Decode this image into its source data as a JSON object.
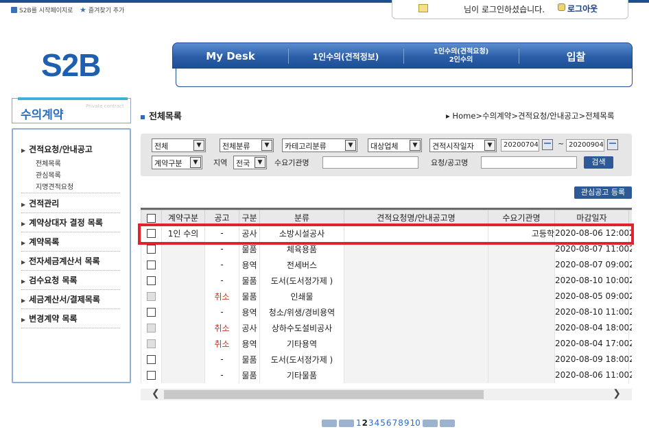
{
  "top_links": {
    "start_page": "S2B를 시작페이지로",
    "favorite": "즐겨찾기 추가"
  },
  "login": {
    "message": "님이 로그인하셨습니다.",
    "logout": "로그아웃"
  },
  "logo": "S2B",
  "nav": {
    "items": [
      {
        "line1": "My Desk",
        "line2": ""
      },
      {
        "line1": "1인수의(견적정보)",
        "line2": ""
      },
      {
        "line1": "1인수의(견적요청)",
        "line2": "2인수의"
      },
      {
        "line1": "입찰",
        "line2": ""
      }
    ]
  },
  "sidebar": {
    "title": "수의계약",
    "subtitle": "Private contract",
    "items": [
      {
        "label": "견적요청/안내공고"
      },
      {
        "label": "견적관리"
      },
      {
        "label": "계약상대자 결정 목록"
      },
      {
        "label": "계약목록"
      },
      {
        "label": "전자세금계산서 목록"
      },
      {
        "label": "검수요청 목록"
      },
      {
        "label": "세금계산서/결제목록"
      },
      {
        "label": "변경계약 목록"
      }
    ],
    "subitems": [
      "전체목록",
      "관심목록",
      "지명견적요청"
    ]
  },
  "page": {
    "title": "전체목록",
    "breadcrumb": "▸ Home>수의계약>견적요청/안내공고>전체목록"
  },
  "filter": {
    "sel_all": "전체",
    "sel_class": "전체분류",
    "sel_category": "카테고리분류",
    "sel_target": "대상업체",
    "sel_datetype": "견적시작일자",
    "date_from": "20200704",
    "tilde": "~",
    "date_to": "20200904",
    "sel_contract": "계약구분",
    "label_region": "지역",
    "sel_region": "전국",
    "label_agency": "수요기관명",
    "label_title": "요청/공고명",
    "search_button": "검색"
  },
  "register_button": "관심공고 등록",
  "table": {
    "headers": [
      "",
      "계약구분",
      "공고",
      "구분",
      "분류",
      "견적요청명/안내공고명",
      "수요기관명",
      "마감일자",
      ""
    ],
    "rows": [
      {
        "contract": "1인 수의",
        "notice": "-",
        "type": "공사",
        "category": "소방시설공사",
        "title": "",
        "agency": "고등학",
        "deadline": "2020-08-06 12:00",
        "extra": "2",
        "disabled": false
      },
      {
        "contract": "",
        "notice": "-",
        "type": "물품",
        "category": "체육용품",
        "title": "",
        "agency": "",
        "deadline": "2020-08-07 11:00",
        "extra": "2",
        "disabled": false
      },
      {
        "contract": "",
        "notice": "-",
        "type": "용역",
        "category": "전세버스",
        "title": "",
        "agency": "",
        "deadline": "2020-08-07 09:00",
        "extra": "2",
        "disabled": false
      },
      {
        "contract": "",
        "notice": "-",
        "type": "물품",
        "category": "도서(도서정가제 )",
        "title": "",
        "agency": "",
        "deadline": "2020-08-10 10:00",
        "extra": "2",
        "disabled": false
      },
      {
        "contract": "",
        "notice": "취소",
        "type": "물품",
        "category": "인쇄물",
        "title": "",
        "agency": "",
        "deadline": "2020-08-05 09:00",
        "extra": "2",
        "disabled": true
      },
      {
        "contract": "",
        "notice": "-",
        "type": "용역",
        "category": "청소/위생/경비용역",
        "title": "",
        "agency": "",
        "deadline": "2020-08-10 11:00",
        "extra": "2",
        "disabled": false
      },
      {
        "contract": "",
        "notice": "취소",
        "type": "공사",
        "category": "상하수도설비공사",
        "title": "",
        "agency": "",
        "deadline": "2020-08-04 18:00",
        "extra": "2",
        "disabled": true
      },
      {
        "contract": "",
        "notice": "취소",
        "type": "용역",
        "category": "기타용역",
        "title": "",
        "agency": "",
        "deadline": "2020-08-04 17:00",
        "extra": "2",
        "disabled": true
      },
      {
        "contract": "",
        "notice": "-",
        "type": "물품",
        "category": "도서(도서정가제 )",
        "title": "",
        "agency": "",
        "deadline": "2020-08-09 18:00",
        "extra": "2",
        "disabled": false
      },
      {
        "contract": "",
        "notice": "-",
        "type": "물품",
        "category": "기타물품",
        "title": "",
        "agency": "",
        "deadline": "2020-08-06 11:00",
        "extra": "2",
        "disabled": false
      }
    ]
  },
  "pager": {
    "pages": [
      "1",
      "2",
      "3",
      "4",
      "5",
      "6",
      "7",
      "8",
      "9",
      "10"
    ],
    "current": "2"
  },
  "colors": {
    "nav_blue": "#2b5ea8",
    "highlight": "#e0232a",
    "cancel_red": "#c0392b",
    "accent": "#2a6cc0"
  }
}
